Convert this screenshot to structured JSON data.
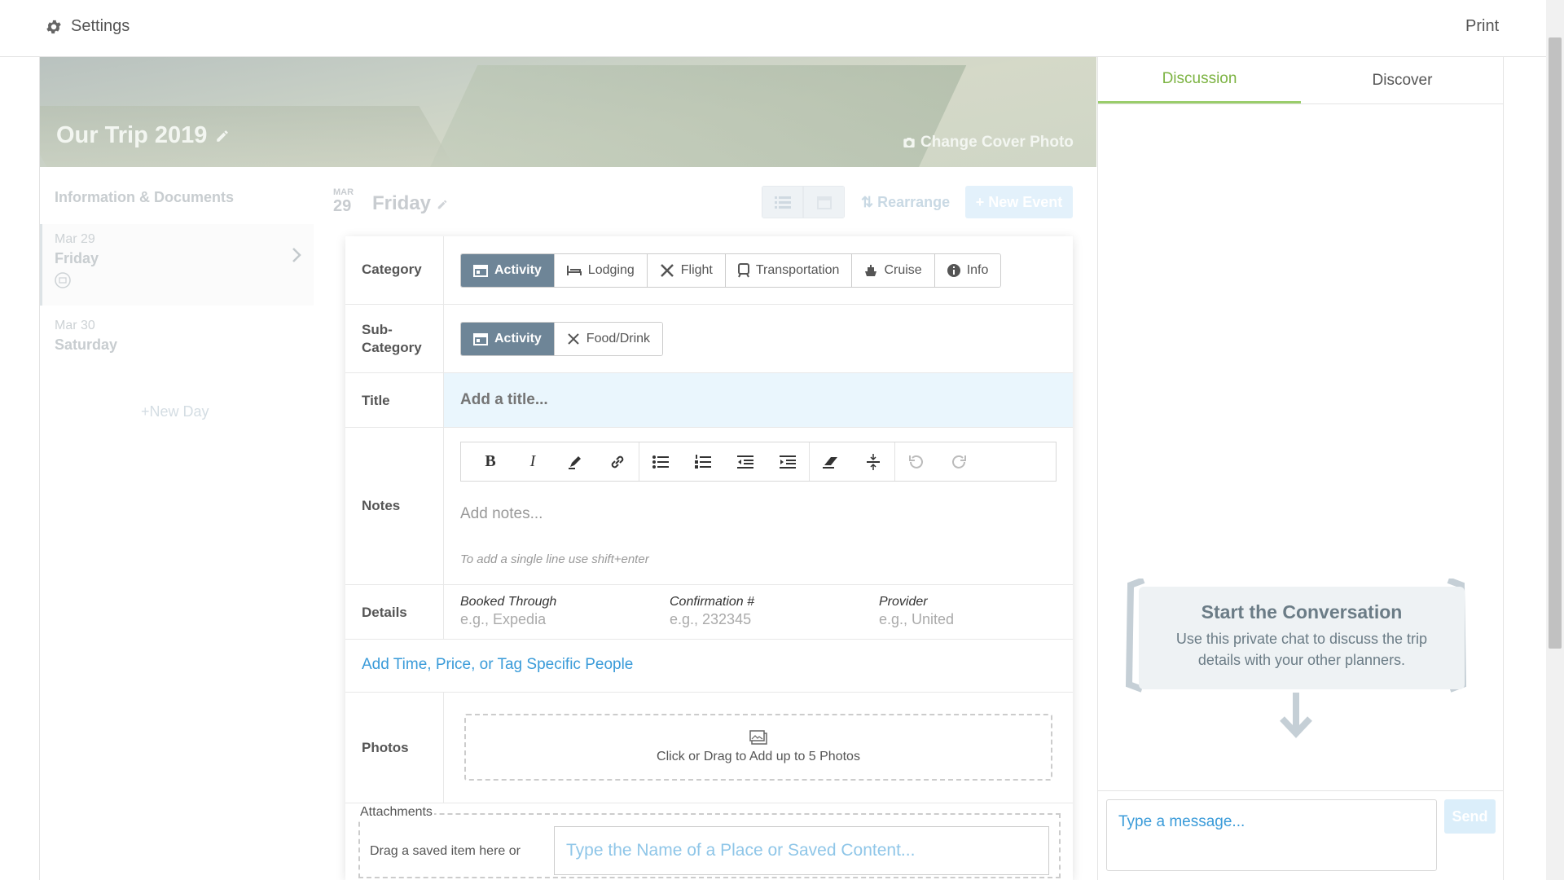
{
  "topbar": {
    "settings_label": "Settings",
    "print_label": "Print"
  },
  "cover": {
    "trip_title": "Our Trip 2019",
    "change_cover_label": "Change Cover Photo"
  },
  "sidebar": {
    "heading": "Information & Documents",
    "days": [
      {
        "date": "Mar 29",
        "name": "Friday"
      },
      {
        "date": "Mar 30",
        "name": "Saturday"
      }
    ],
    "new_day_label": "New Day"
  },
  "day_header": {
    "month": "MAR",
    "day_number": "29",
    "day_name": "Friday",
    "rearrange_label": "Rearrange",
    "new_event_label": "New Event"
  },
  "form": {
    "category_label": "Category",
    "categories": [
      "Activity",
      "Lodging",
      "Flight",
      "Transportation",
      "Cruise",
      "Info"
    ],
    "selected_category": "Activity",
    "subcategory_label": "Sub-\nCategory",
    "subcategories": [
      "Activity",
      "Food/Drink"
    ],
    "selected_subcategory": "Activity",
    "title_label": "Title",
    "title_placeholder": "Add a title...",
    "notes_label": "Notes",
    "notes_placeholder": "Add notes...",
    "notes_hint": "To add a single line use shift+enter",
    "details_label": "Details",
    "details": [
      {
        "label": "Booked Through",
        "placeholder": "e.g., Expedia"
      },
      {
        "label": "Confirmation #",
        "placeholder": "e.g., 232345"
      },
      {
        "label": "Provider",
        "placeholder": "e.g., United"
      }
    ],
    "add_time_link": "Add Time, Price, or Tag Specific People",
    "photos_label": "Photos",
    "photos_drop_text": "Click or Drag to Add up to 5 Photos",
    "attachments_label": "Attachments",
    "attachments_drag_text": "Drag a saved item here or",
    "attachments_placeholder": "Type the Name of a Place or Saved Content..."
  },
  "right_panel": {
    "tabs": [
      "Discussion",
      "Discover"
    ],
    "active_tab": "Discussion",
    "conversation_title": "Start the Conversation",
    "conversation_text": "Use this private chat to discuss the trip details with your other planners.",
    "message_placeholder": "Type a message...",
    "send_label": "Send"
  },
  "colors": {
    "accent_green": "#7cb342",
    "link_blue": "#3a9bd9",
    "selected_segment": "#6e8597"
  }
}
